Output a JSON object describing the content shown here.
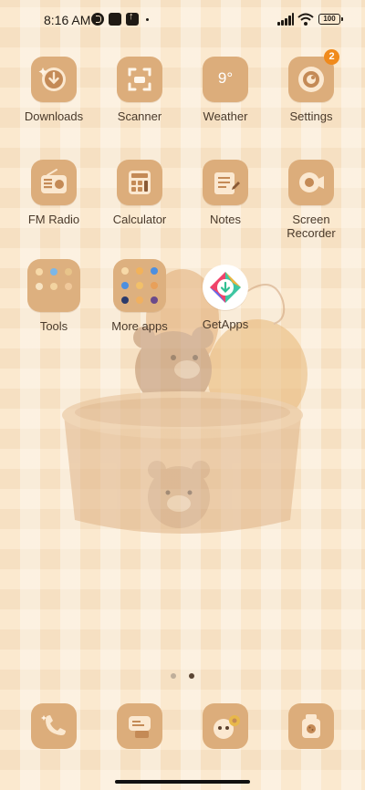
{
  "status_bar": {
    "time": "8:16 AM",
    "battery": "100"
  },
  "apps": [
    {
      "label": "Downloads",
      "icon": "download-icon"
    },
    {
      "label": "Scanner",
      "icon": "scan-icon"
    },
    {
      "label": "Weather",
      "icon": "weather-icon",
      "icon_text": "9°"
    },
    {
      "label": "Settings",
      "icon": "settings-icon",
      "badge": "2"
    },
    {
      "label": "FM Radio",
      "icon": "radio-icon"
    },
    {
      "label": "Calculator",
      "icon": "calculator-icon"
    },
    {
      "label": "Notes",
      "icon": "notes-icon"
    },
    {
      "label": "Screen Recorder",
      "icon": "screen-recorder-icon"
    },
    {
      "label": "Tools",
      "icon": "folder-icon"
    },
    {
      "label": "More apps",
      "icon": "folder-icon"
    },
    {
      "label": "GetApps",
      "icon": "getapps-icon"
    }
  ],
  "pager": {
    "pages": 2,
    "current": 2
  },
  "dock": [
    {
      "icon": "phone-icon"
    },
    {
      "icon": "messages-icon"
    },
    {
      "icon": "browser-icon"
    },
    {
      "icon": "camera-icon"
    }
  ],
  "colors": {
    "background": "#fbe9cf",
    "icon_tile": "#dcad7b",
    "label": "#4a3a2b",
    "badge": "#f08a1c"
  }
}
